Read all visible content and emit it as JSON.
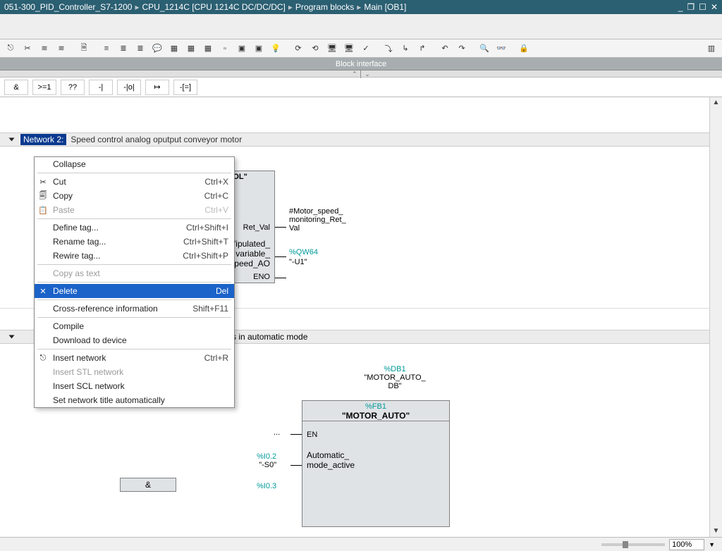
{
  "breadcrumb": {
    "p1": "051-300_PID_Controller_S7-1200",
    "p2": "CPU_1214C [CPU 1214C DC/DC/DC]",
    "p3": "Program blocks",
    "p4": "Main [OB1]"
  },
  "block_interface": "Block interface",
  "ladder_btns": {
    "b0": "&",
    "b1": ">=1",
    "b2": "??",
    "b3": "-|",
    "b4": "-|o|",
    "b5": "↦",
    "b6": "-[=]"
  },
  "network2": {
    "label": "Network 2:",
    "desc": "Speed control analog oputput conveyor motor",
    "fb_name_trunc": "\"ROL\"",
    "ret_val_label": "Ret_Val",
    "pv_lbl1": "\"ipulated_",
    "pv_lbl2": "variable_",
    "pv_lbl3": "peed_AO",
    "eno_label": "ENO",
    "ret_tag1": "#Motor_speed_",
    "ret_tag2": "monitoring_Ret_",
    "ret_tag3": "Val",
    "qw_tag": "%QW64",
    "qw_sym": "\"-U1\""
  },
  "network3": {
    "title_vis": "s in automatic mode",
    "db_tag": "%DB1",
    "db_name1": "\"MOTOR_AUTO_",
    "db_name2": "DB\"",
    "fb_tag": "%FB1",
    "fb_name": "\"MOTOR_AUTO\"",
    "en_dots": "...",
    "en_label": "EN",
    "auto_lbl1": "Automatic_",
    "auto_lbl2": "mode_active",
    "i02": "%I0.2",
    "s0": "\"-S0\"",
    "i03": "%I0.3",
    "and": "&"
  },
  "context_menu": {
    "collapse": "Collapse",
    "cut": "Cut",
    "cut_sc": "Ctrl+X",
    "copy": "Copy",
    "copy_sc": "Ctrl+C",
    "paste": "Paste",
    "paste_sc": "Ctrl+V",
    "define": "Define tag...",
    "define_sc": "Ctrl+Shift+I",
    "rename": "Rename tag...",
    "rename_sc": "Ctrl+Shift+T",
    "rewire": "Rewire tag...",
    "rewire_sc": "Ctrl+Shift+P",
    "copytxt": "Copy as text",
    "delete": "Delete",
    "delete_sc": "Del",
    "xref": "Cross-reference information",
    "xref_sc": "Shift+F11",
    "compile": "Compile",
    "download": "Download to device",
    "insnet": "Insert network",
    "insnet_sc": "Ctrl+R",
    "insstl": "Insert STL network",
    "insscl": "Insert SCL network",
    "autotitle": "Set network title automatically"
  },
  "status": {
    "zoom": "100%"
  }
}
